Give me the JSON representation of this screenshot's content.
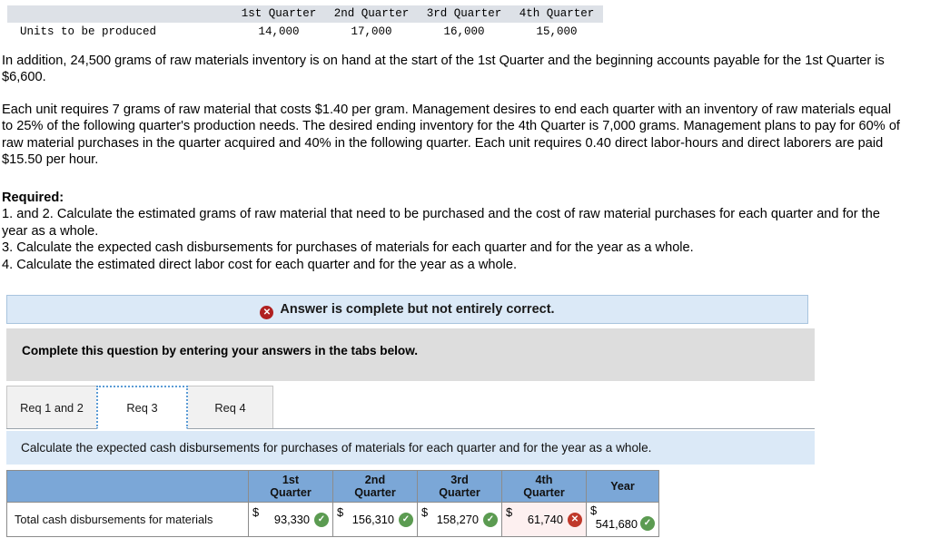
{
  "top_table": {
    "columns": [
      "",
      "1st Quarter",
      "2nd Quarter",
      "3rd Quarter",
      "4th Quarter"
    ],
    "rows": [
      {
        "label": "Units to be produced",
        "values": [
          "14,000",
          "17,000",
          "16,000",
          "15,000"
        ]
      }
    ]
  },
  "prose": {
    "paragraph1": "In addition, 24,500 grams of raw materials inventory is on hand at the start of the 1st Quarter and the beginning accounts payable for the 1st Quarter is $6,600.",
    "paragraph2": "Each unit requires 7 grams of raw material that costs $1.40 per gram. Management desires to end each quarter with an inventory of raw materials equal to 25% of the following quarter's production needs. The desired ending inventory for the 4th Quarter is 7,000 grams. Management plans to pay for 60% of raw material purchases in the quarter acquired and 40% in the following quarter. Each unit requires 0.40 direct labor-hours and direct laborers are paid $15.50 per hour.",
    "required_heading": "Required:",
    "required_items": [
      "1. and 2. Calculate the estimated grams of raw material that need to be purchased and the cost of raw material purchases for each quarter and for the year as a whole.",
      "3. Calculate the expected cash disbursements for purchases of materials for each quarter and for the year as a whole.",
      "4. Calculate the estimated direct labor cost for each quarter and for the year as a whole."
    ]
  },
  "alert": {
    "icon": "x-circle-icon",
    "icon_glyph": "✕",
    "text": "Answer is complete but not entirely correct.",
    "background": "#dbe9f7",
    "border": "#a8c4de",
    "icon_color": "#b02020"
  },
  "instruction_band": {
    "text": "Complete this question by entering your answers in the tabs below.",
    "background": "#dddddd"
  },
  "tabs": [
    {
      "label": "Req 1 and 2",
      "active": false
    },
    {
      "label": "Req 3",
      "active": true
    },
    {
      "label": "Req 4",
      "active": false
    }
  ],
  "question_band": {
    "text": "Calculate the expected cash disbursements for purchases of materials for each quarter and for the year as a whole.",
    "background": "#dbe9f7"
  },
  "answer_table": {
    "header_background": "#7ba7d7",
    "columns": [
      {
        "label": "",
        "line1": "",
        "line2": ""
      },
      {
        "label": "1st Quarter",
        "line1": "1st",
        "line2": "Quarter"
      },
      {
        "label": "2nd Quarter",
        "line1": "2nd",
        "line2": "Quarter"
      },
      {
        "label": "3rd Quarter",
        "line1": "3rd",
        "line2": "Quarter"
      },
      {
        "label": "4th Quarter",
        "line1": "4th",
        "line2": "Quarter"
      },
      {
        "label": "Year",
        "line1": "Year",
        "line2": ""
      }
    ],
    "rows": [
      {
        "label": "Total cash disbursements for materials",
        "cells": [
          {
            "currency": "$",
            "amount": "93,330",
            "status": "correct",
            "status_glyph": "✓"
          },
          {
            "currency": "$",
            "amount": "156,310",
            "status": "correct",
            "status_glyph": "✓"
          },
          {
            "currency": "$",
            "amount": "158,270",
            "status": "correct",
            "status_glyph": "✓"
          },
          {
            "currency": "$",
            "amount": "61,740",
            "status": "incorrect",
            "status_glyph": "✕"
          },
          {
            "currency": "$",
            "amount": "541,680",
            "status": "correct",
            "status_glyph": "✓"
          }
        ]
      }
    ],
    "status_colors": {
      "correct": "#5b9b51",
      "incorrect": "#c0392b"
    }
  }
}
